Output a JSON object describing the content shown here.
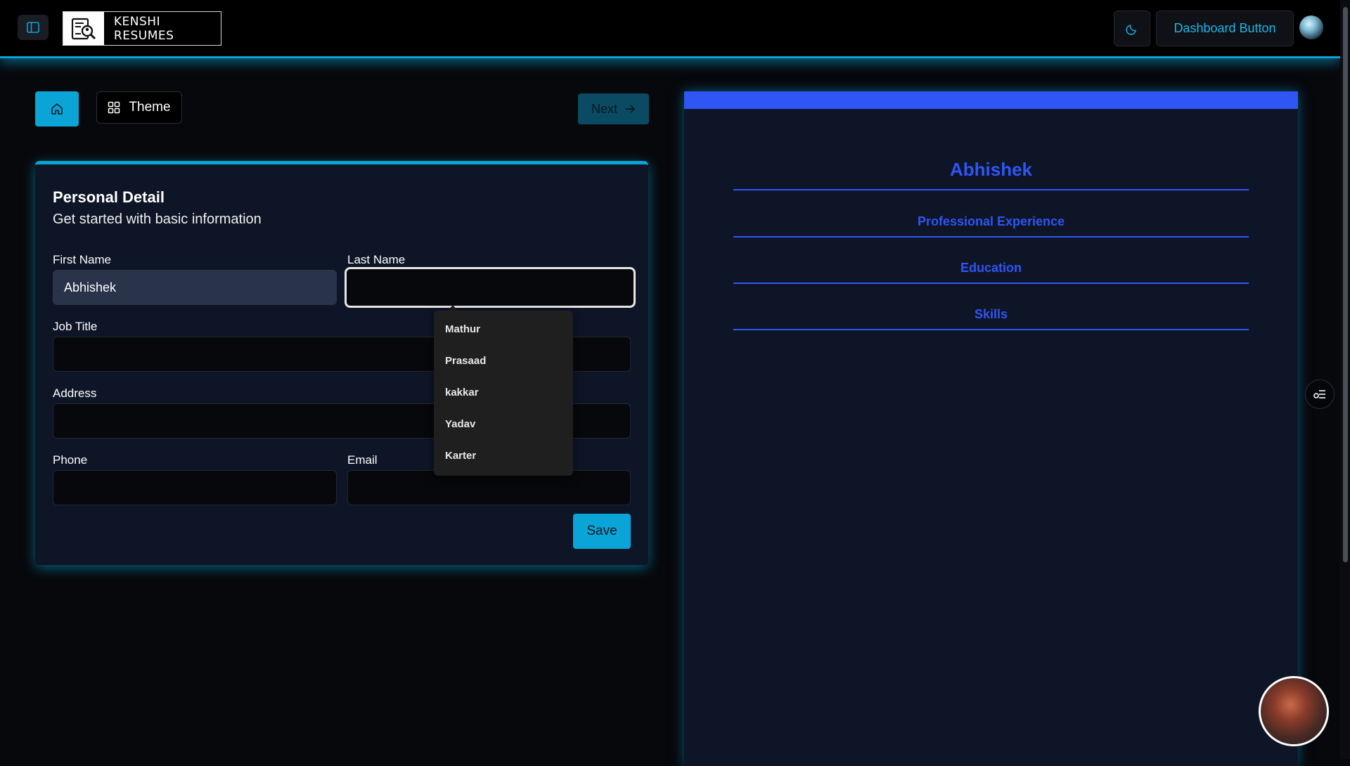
{
  "header": {
    "brand": "KENSHI RESUMES",
    "dashboard_button": "Dashboard Button",
    "icons": {
      "sidebar_toggle": "sidebar-icon",
      "theme_toggle": "moon-icon"
    }
  },
  "toolbar": {
    "theme_label": "Theme",
    "next_label": "Next"
  },
  "form": {
    "title": "Personal Detail",
    "subtitle": "Get started with basic information",
    "first_name_label": "First Name",
    "first_name_value": "Abhishek",
    "last_name_label": "Last Name",
    "last_name_value": "",
    "job_title_label": "Job Title",
    "address_label": "Address",
    "phone_label": "Phone",
    "email_label": "Email",
    "save_label": "Save"
  },
  "autocomplete": {
    "options": [
      "Mathur",
      "Prasaad",
      "kakkar",
      "Yadav",
      "Karter"
    ]
  },
  "preview": {
    "name": "Abhishek",
    "sections": [
      "Professional Experience",
      "Education",
      "Skills"
    ],
    "accent": "#2f55f5"
  },
  "colors": {
    "primary": "#0aa5d6",
    "background": "#07080c",
    "card": "#0e1526"
  }
}
